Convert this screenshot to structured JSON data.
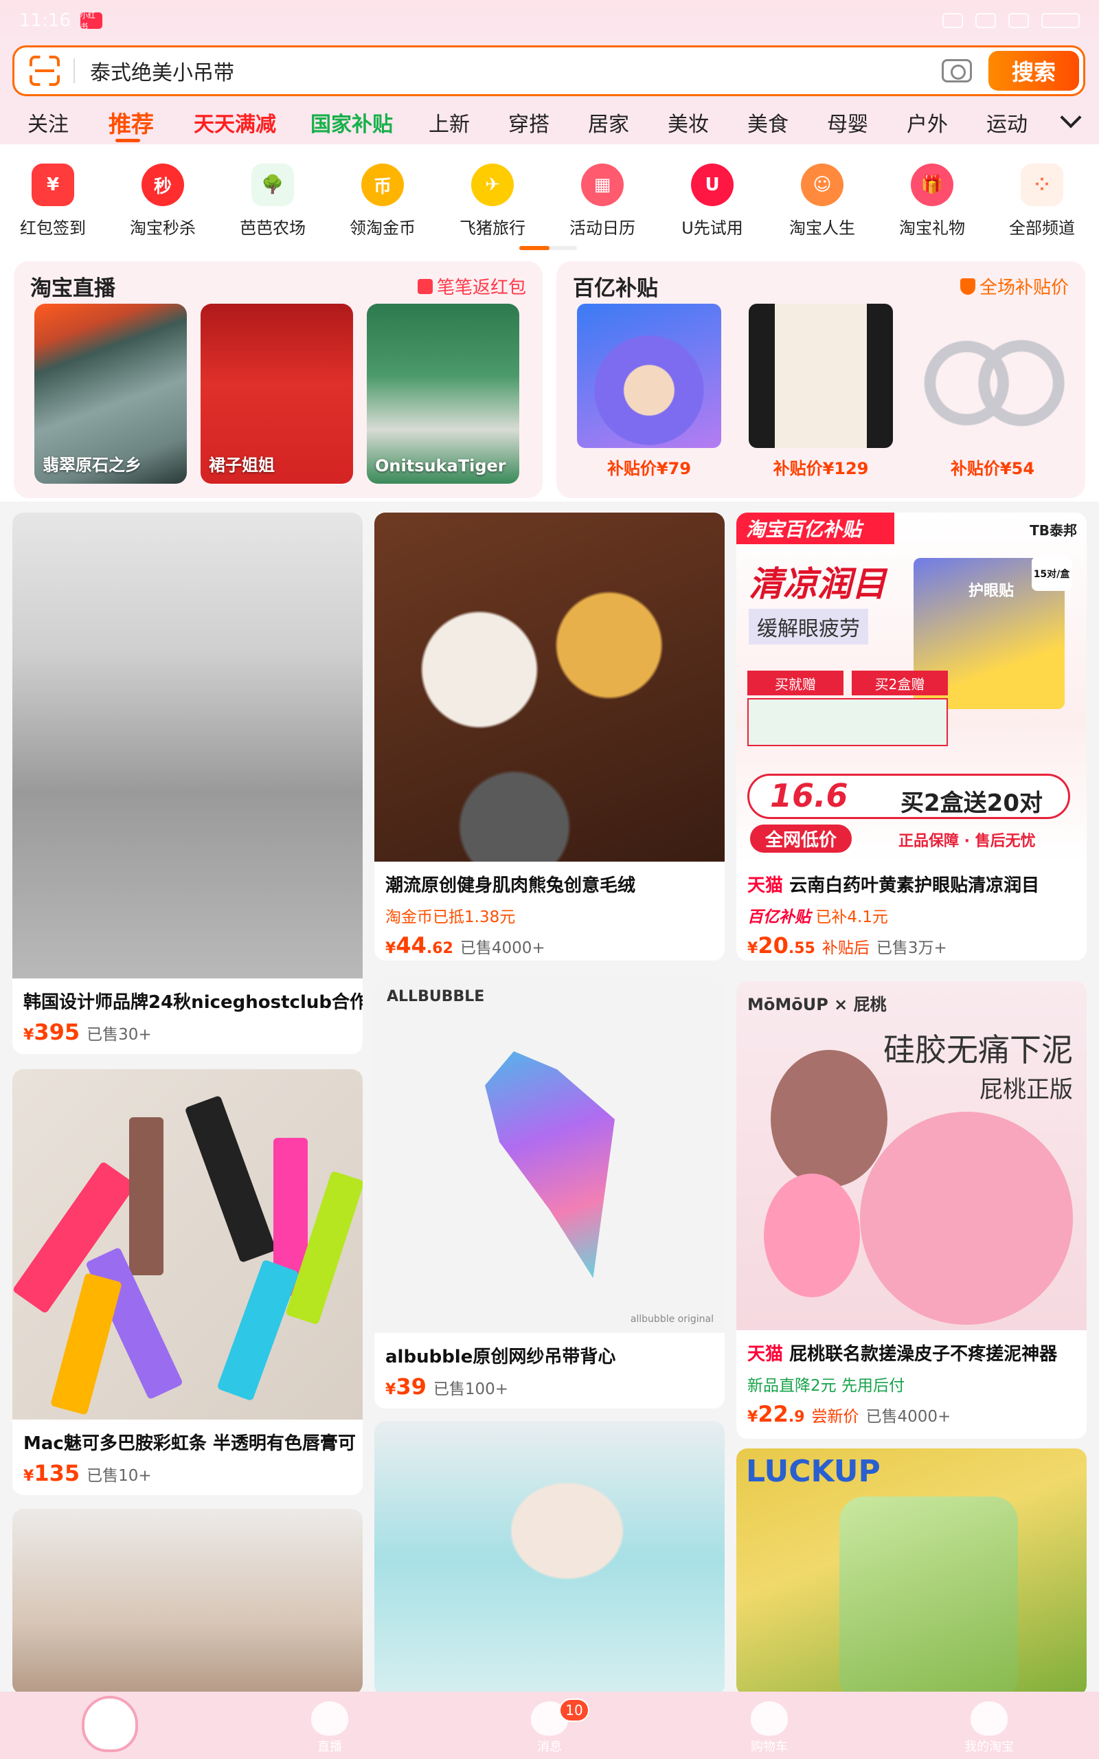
{
  "status_bar": {
    "time": "11:16",
    "app_badge": "小红书"
  },
  "search": {
    "query": "泰式绝美小吊带",
    "button_label": "搜索"
  },
  "category_tabs": [
    "关注",
    "推荐",
    "天天满减",
    "国家补贴",
    "上新",
    "穿搭",
    "居家",
    "美妆",
    "美食",
    "母婴",
    "户外",
    "运动"
  ],
  "channels": [
    {
      "label": "红包签到",
      "icon": "red-envelope-icon",
      "glyph": "¥",
      "color": "#ff3b3b"
    },
    {
      "label": "淘宝秒杀",
      "icon": "alarm-clock-icon",
      "glyph": "秒",
      "color": "#ff2d2d"
    },
    {
      "label": "芭芭农场",
      "icon": "farm-tree-icon",
      "glyph": "🌳",
      "color": "#2ecc40"
    },
    {
      "label": "领淘金币",
      "icon": "gold-coin-icon",
      "glyph": "币",
      "color": "#ffb400"
    },
    {
      "label": "飞猪旅行",
      "icon": "flying-pig-icon",
      "glyph": "✈",
      "color": "#ffcc00"
    },
    {
      "label": "活动日历",
      "icon": "calendar-icon",
      "glyph": "▦",
      "color": "#ff5a6e"
    },
    {
      "label": "U先试用",
      "icon": "u-trial-icon",
      "glyph": "U",
      "color": "#ff1744"
    },
    {
      "label": "淘宝人生",
      "icon": "avatar-icon",
      "glyph": "☺",
      "color": "#ff8a3d"
    },
    {
      "label": "淘宝礼物",
      "icon": "gift-icon",
      "glyph": "🎁",
      "color": "#ff4d6d"
    },
    {
      "label": "全部频道",
      "icon": "all-channels-icon",
      "glyph": "⁘",
      "color": "#ff7043"
    }
  ],
  "live": {
    "title": "淘宝直播",
    "tag": "笔笔返红包",
    "items": [
      {
        "label": "翡翠原石之乡"
      },
      {
        "label": "裙子姐姐"
      },
      {
        "label": "OnitsukaTiger"
      }
    ]
  },
  "subsidy": {
    "title": "百亿补贴",
    "tag": "全场补贴价",
    "items": [
      {
        "price": "补贴价¥79"
      },
      {
        "price": "补贴价¥129"
      },
      {
        "price": "补贴价¥54"
      }
    ]
  },
  "products": {
    "p1": {
      "title": "韩国设计师品牌24秋niceghostclub合作",
      "price": "395",
      "sold": "已售30+"
    },
    "p2": {
      "title": "潮流原创健身肌肉熊兔创意毛绒",
      "sub": "淘金币已抵1.38元",
      "price_int": "44",
      "price_dec": ".62",
      "sold": "已售4000+"
    },
    "p3": {
      "tmall": "天猫",
      "title": "云南白药叶黄素护眼贴清凉润目",
      "bybt": "百亿补贴",
      "sub": "已补4.1元",
      "price_int": "20",
      "price_dec": ".55",
      "note": "补贴后",
      "sold": "已售3万+",
      "img": {
        "banner": "淘宝百亿补贴",
        "brand": "TB泰邦",
        "headline": "清凉润目",
        "sub": "缓解眼疲劳",
        "box_label": "护眼贴",
        "count": "15对/盒",
        "buy_label": "买就赠",
        "buy2_label": "买2盒赠",
        "price": "16.6",
        "promo": "买2盒送20对",
        "lowest": "全网低价",
        "guarantee": "正品保障 · 售后无忧"
      }
    },
    "p4": {
      "title": "albubble原创网纱吊带背心",
      "price": "39",
      "sold": "已售100+",
      "img": {
        "brand": "ALLBUBBLE",
        "footer": "allbubble original"
      }
    },
    "p5": {
      "tmall": "天猫",
      "title": "屁桃联名款搓澡皮子不疼搓泥神器",
      "sub_green": "新品直降2元",
      "sub_orange": "先用后付",
      "price_int": "22",
      "price_dec": ".9",
      "note": "尝新价",
      "sold": "已售4000+",
      "img": {
        "brand": "MōMōUP × 屁桃",
        "headline": "硅胶无痛下泥",
        "sub": "屁桃正版"
      }
    },
    "p6": {
      "title": "Mac魅可多巴胺彩虹条 半透明有色唇膏可",
      "price": "135",
      "sold": "已售10+"
    },
    "p7": {
      "img": {
        "brand": "LUCKUP"
      }
    }
  },
  "bottom_nav": [
    {
      "label": ""
    },
    {
      "label": "直播"
    },
    {
      "label": "消息",
      "badge": "10"
    },
    {
      "label": "购物车"
    },
    {
      "label": "我的淘宝"
    }
  ],
  "colors": {
    "accent": "#ff5000",
    "tmall": "#ff0036",
    "header_bg": "#fbe7ee"
  }
}
